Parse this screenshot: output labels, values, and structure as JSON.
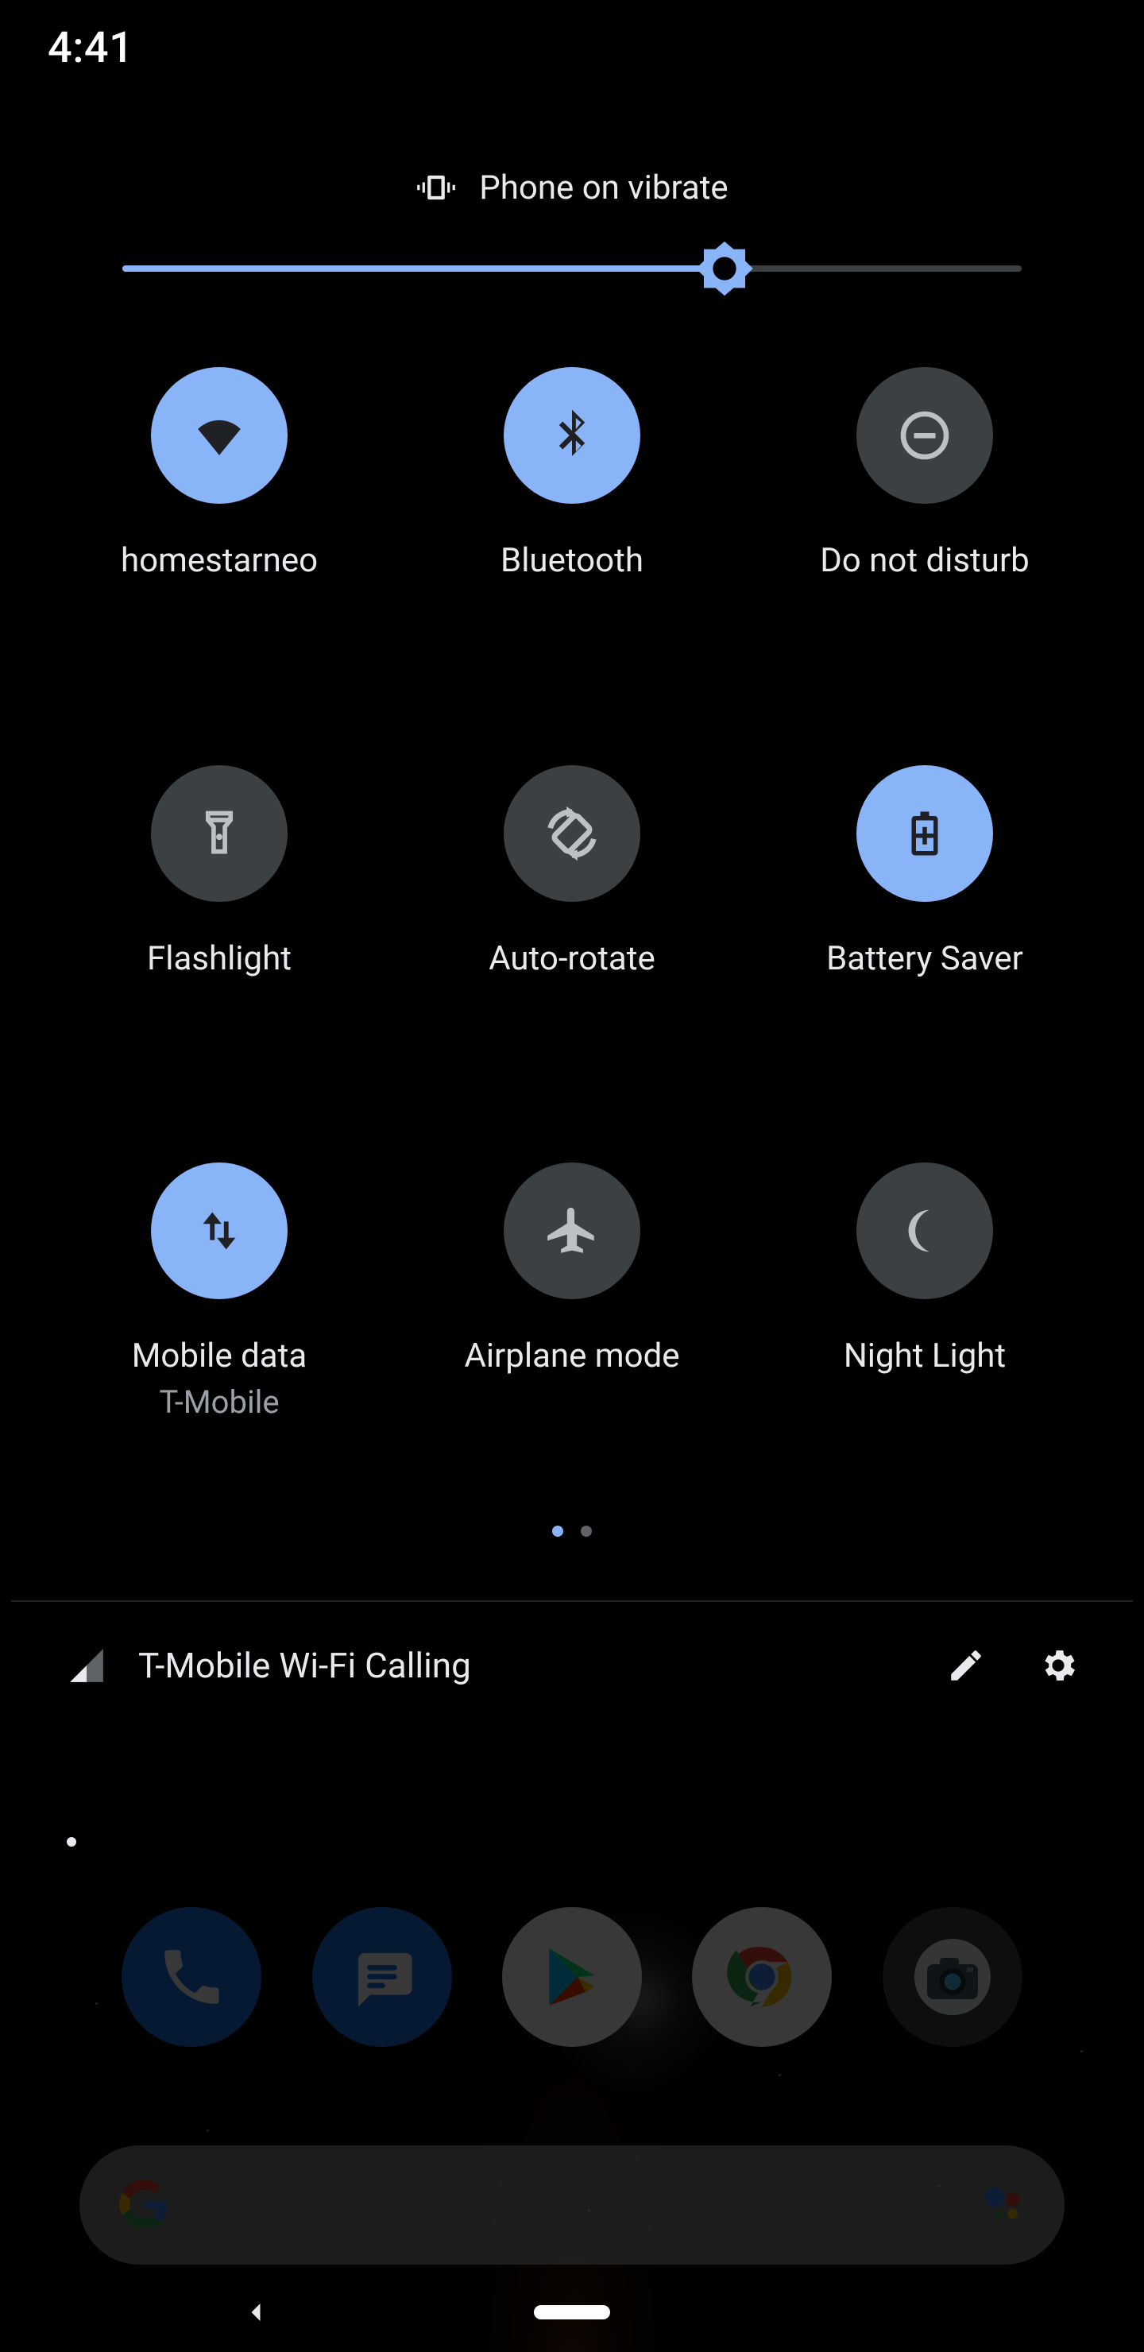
{
  "status": {
    "time": "4:41"
  },
  "ringer": {
    "label": "Phone on vibrate",
    "mode": "vibrate"
  },
  "brightness": {
    "percent": 67
  },
  "tiles": [
    {
      "id": "wifi",
      "label": "homestarneo",
      "sublabel": "",
      "active": true
    },
    {
      "id": "bluetooth",
      "label": "Bluetooth",
      "sublabel": "",
      "active": true
    },
    {
      "id": "dnd",
      "label": "Do not disturb",
      "sublabel": "",
      "active": false
    },
    {
      "id": "flashlight",
      "label": "Flashlight",
      "sublabel": "",
      "active": false
    },
    {
      "id": "autorotate",
      "label": "Auto-rotate",
      "sublabel": "",
      "active": false
    },
    {
      "id": "batterysaver",
      "label": "Battery Saver",
      "sublabel": "",
      "active": true
    },
    {
      "id": "mobiledata",
      "label": "Mobile data",
      "sublabel": "T-Mobile",
      "active": true
    },
    {
      "id": "airplane",
      "label": "Airplane mode",
      "sublabel": "",
      "active": false
    },
    {
      "id": "nightlight",
      "label": "Night Light",
      "sublabel": "",
      "active": false
    }
  ],
  "pages": {
    "count": 2,
    "current": 0
  },
  "footer": {
    "carrier": "T-Mobile Wi-Fi Calling"
  }
}
